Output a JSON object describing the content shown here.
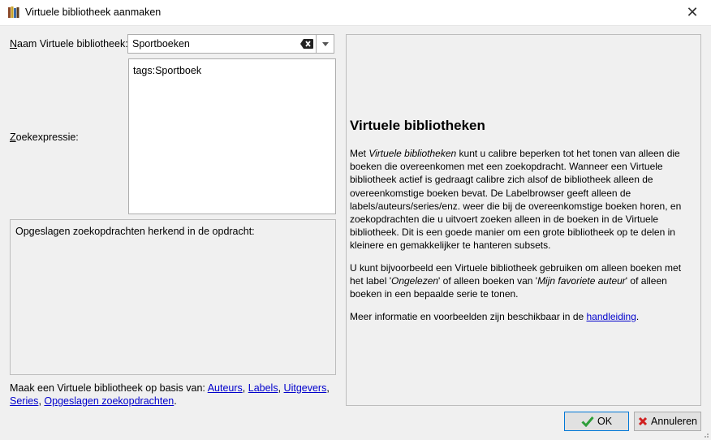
{
  "window": {
    "title": "Virtuele bibliotheek aanmaken"
  },
  "form": {
    "name_label_first": "N",
    "name_label_rest": "aam Virtuele bibliotheek:",
    "name_value": "Sportboeken",
    "expr_label_first": "Z",
    "expr_label_rest": "oekexpressie:",
    "expr_value": "tags:Sportboek",
    "saved_searches_text": "Opgeslagen zoekopdrachten herkend in de opdracht:"
  },
  "create_from": {
    "prefix": "Maak een Virtuele bibliotheek op basis van:",
    "links": [
      "Auteurs",
      "Labels",
      "Uitgevers",
      "Series",
      "Opgeslagen zoekopdrachten"
    ]
  },
  "help": {
    "heading": "Virtuele bibliotheken",
    "p1_a": "Met ",
    "p1_em": "Virtuele bibliotheken",
    "p1_b": " kunt u calibre beperken tot het tonen van alleen die boeken die overeenkomen met een zoekopdracht. Wanneer een Virtuele bibliotheek actief is gedraagt calibre zich alsof de bibliotheek alleen de overeenkomstige boeken bevat. De Labelbrowser geeft alleen de labels/auteurs/series/enz. weer die bij de overeenkomstige boeken horen, en zoekopdrachten die u uitvoert zoeken alleen in de boeken in de Virtuele bibliotheek. Dit is een goede manier om een grote bibliotheek op te delen in kleinere en gemakkelijker te hanteren subsets.",
    "p2_a": "U kunt bijvoorbeeld een Virtuele bibliotheek gebruiken om alleen boeken met het label '",
    "p2_em1": "Ongelezen",
    "p2_b": "' of alleen boeken van '",
    "p2_em2": "Mijn favoriete auteur",
    "p2_c": "' of alleen boeken in een bepaalde serie te tonen.",
    "p3_a": "Meer informatie en voorbeelden zijn beschikbaar in de ",
    "p3_link": "handleiding",
    "p3_b": "."
  },
  "buttons": {
    "ok": "OK",
    "cancel": "Annuleren"
  },
  "colors": {
    "link": "#0000cc",
    "ok_check": "#2e9e3a",
    "cancel_x": "#d02020"
  },
  "icons": [
    "calibre-books-icon",
    "close-icon",
    "clear-text-icon",
    "chevron-down-icon",
    "checkmark-icon",
    "x-mark-icon"
  ]
}
